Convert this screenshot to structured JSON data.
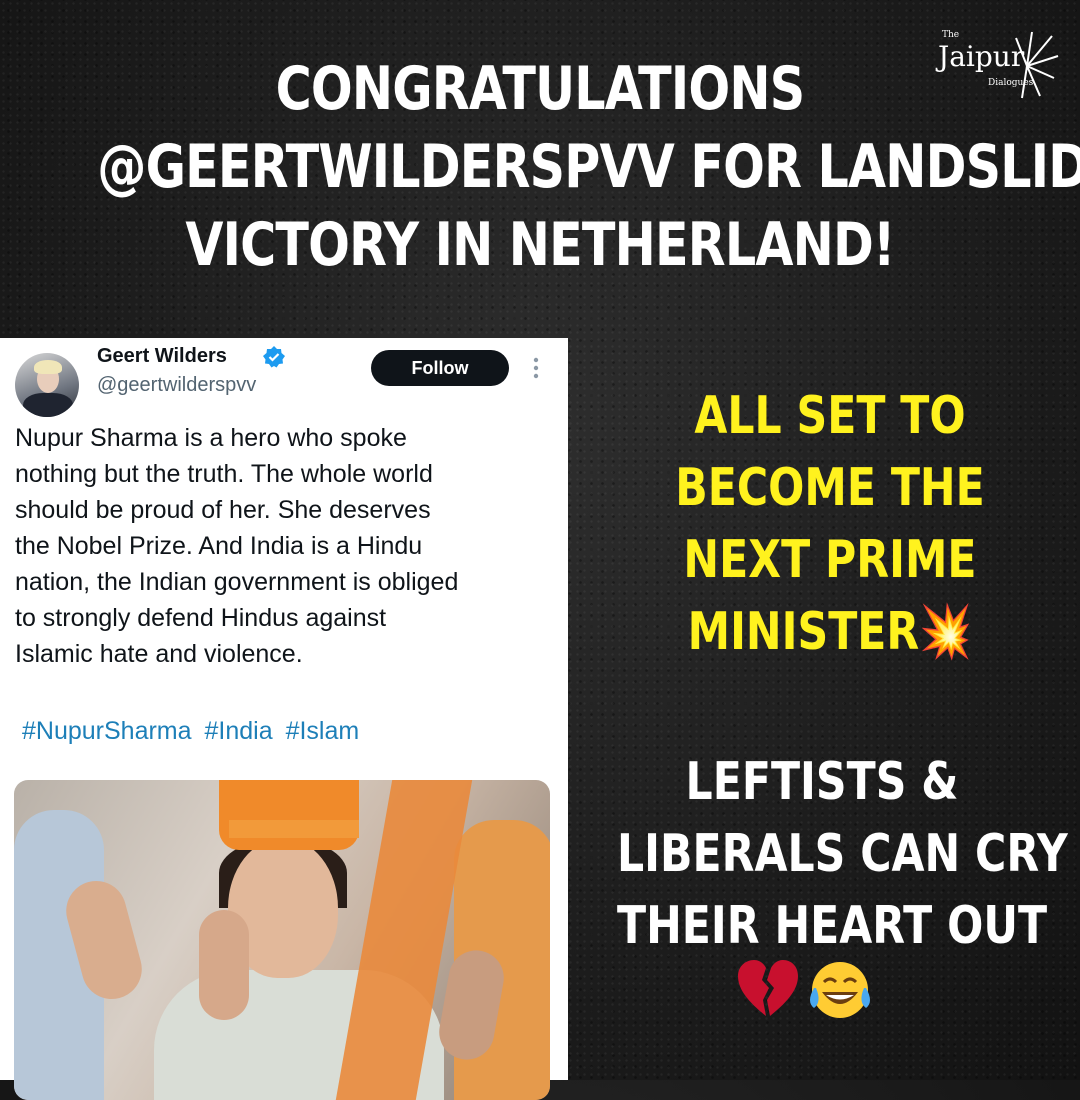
{
  "headline": {
    "line1": "CONGRATULATIONS",
    "line2": "@GEERTWILDERSPVV FOR LANDSLIDE",
    "line3": "VICTORY IN NETHERLAND!"
  },
  "logo": {
    "small": "The",
    "brand": "Jaipur",
    "sub": "Dialogues"
  },
  "tweet": {
    "name": "Geert Wilders",
    "handle": "@geertwilderspvv",
    "follow_label": "Follow",
    "body_lines": [
      "Nupur Sharma is a hero who spoke",
      "nothing but the truth. The whole world",
      "should be proud of her. She deserves",
      "the Nobel Prize. And India is a Hindu",
      "nation, the Indian government is obliged",
      "to strongly defend Hindus against",
      "Islamic hate and violence."
    ],
    "hashtags": [
      "#NupurSharma",
      "#India",
      "#Islam"
    ]
  },
  "side_yellow": {
    "lines": [
      "ALL SET TO",
      "BECOME THE",
      "NEXT PRIME",
      "MINISTER💥"
    ]
  },
  "side_white": {
    "lines": [
      "LEFTISTS &",
      "LIBERALS CAN CRY",
      "THEIR HEART OUT"
    ]
  },
  "emojis": [
    "broken-heart-icon",
    "tears-of-joy-icon"
  ],
  "colors": {
    "background": "#1d1d1d",
    "headline": "#ffffff",
    "accent_yellow": "#fff21e",
    "hashtag_blue": "#1d7fb8",
    "follow_button": "#0f1419"
  }
}
